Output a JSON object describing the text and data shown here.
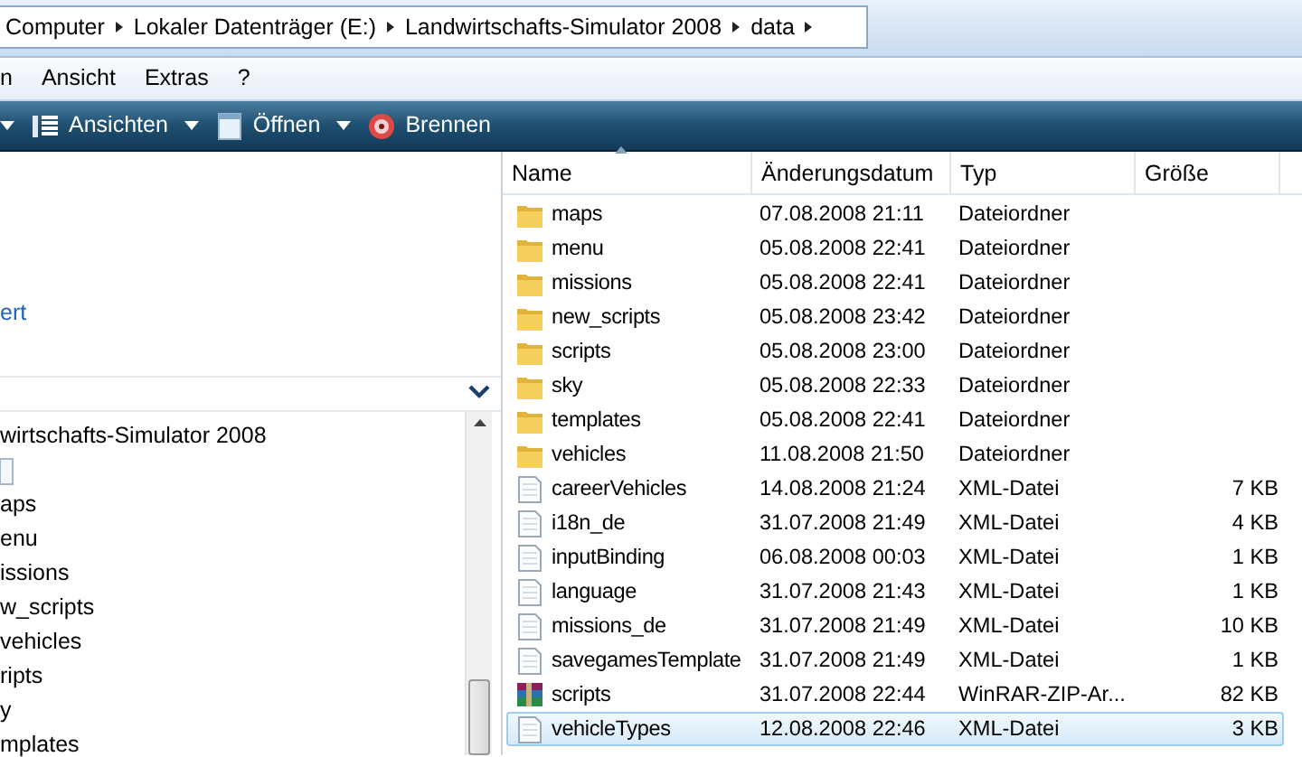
{
  "address_bar": {
    "crumbs": [
      "Computer",
      "Lokaler Datenträger (E:)",
      "Landwirtschafts-Simulator 2008",
      "data"
    ]
  },
  "menu": [
    "n",
    "Ansicht",
    "Extras",
    "?"
  ],
  "toolbar": [
    {
      "kind": "dropdown"
    },
    {
      "kind": "views",
      "label": "Ansichten"
    },
    {
      "kind": "dropdown"
    },
    {
      "kind": "notepad",
      "label": "Öffnen"
    },
    {
      "kind": "dropdown"
    },
    {
      "kind": "disc",
      "label": "Brennen"
    }
  ],
  "left_pane": {
    "link": "ert",
    "tree": [
      {
        "kind": "text",
        "label": "wirtschafts-Simulator 2008"
      },
      {
        "kind": "icon"
      },
      {
        "kind": "text",
        "label": "aps"
      },
      {
        "kind": "text",
        "label": "enu"
      },
      {
        "kind": "text",
        "label": "issions"
      },
      {
        "kind": "text",
        "label": "w_scripts"
      },
      {
        "kind": "text",
        "label": "vehicles"
      },
      {
        "kind": "text",
        "label": "ripts"
      },
      {
        "kind": "text",
        "label": "y"
      },
      {
        "kind": "text",
        "label": "mplates"
      }
    ]
  },
  "file_list": {
    "columns": [
      "Name",
      "Änderungsdatum",
      "Typ",
      "Größe"
    ],
    "rows": [
      {
        "kind": "folder",
        "name": "maps",
        "date": "07.08.2008 21:11",
        "type": "Dateiordner",
        "selected": false
      },
      {
        "kind": "folder",
        "name": "menu",
        "date": "05.08.2008 22:41",
        "type": "Dateiordner",
        "selected": false
      },
      {
        "kind": "folder",
        "name": "missions",
        "date": "05.08.2008 22:41",
        "type": "Dateiordner",
        "selected": false
      },
      {
        "kind": "folder",
        "name": "new_scripts",
        "date": "05.08.2008 23:42",
        "type": "Dateiordner",
        "selected": false
      },
      {
        "kind": "folder",
        "name": "scripts",
        "date": "05.08.2008 23:00",
        "type": "Dateiordner",
        "selected": false
      },
      {
        "kind": "folder",
        "name": "sky",
        "date": "05.08.2008 22:33",
        "type": "Dateiordner",
        "selected": false
      },
      {
        "kind": "folder",
        "name": "templates",
        "date": "05.08.2008 22:41",
        "type": "Dateiordner",
        "selected": false
      },
      {
        "kind": "folder",
        "name": "vehicles",
        "date": "11.08.2008 21:50",
        "type": "Dateiordner",
        "selected": false
      },
      {
        "kind": "xml",
        "name": "careerVehicles",
        "date": "14.08.2008 21:24",
        "type": "XML-Datei",
        "size": "7 KB",
        "selected": false
      },
      {
        "kind": "xml",
        "name": "i18n_de",
        "date": "31.07.2008 21:49",
        "type": "XML-Datei",
        "size": "4 KB",
        "selected": false
      },
      {
        "kind": "xml",
        "name": "inputBinding",
        "date": "06.08.2008 00:03",
        "type": "XML-Datei",
        "size": "1 KB",
        "selected": false
      },
      {
        "kind": "xml",
        "name": "language",
        "date": "31.07.2008 21:43",
        "type": "XML-Datei",
        "size": "1 KB",
        "selected": false
      },
      {
        "kind": "xml",
        "name": "missions_de",
        "date": "31.07.2008 21:49",
        "type": "XML-Datei",
        "size": "10 KB",
        "selected": false
      },
      {
        "kind": "xml",
        "name": "savegamesTemplate",
        "date": "31.07.2008 21:49",
        "type": "XML-Datei",
        "size": "1 KB",
        "selected": false
      },
      {
        "kind": "archive",
        "name": "scripts",
        "date": "31.07.2008 22:44",
        "type": "WinRAR-ZIP-Ar...",
        "size": "82 KB",
        "selected": false
      },
      {
        "kind": "xml",
        "name": "vehicleTypes",
        "date": "12.08.2008 22:46",
        "type": "XML-Datei",
        "size": "3 KB",
        "selected": true
      }
    ]
  }
}
